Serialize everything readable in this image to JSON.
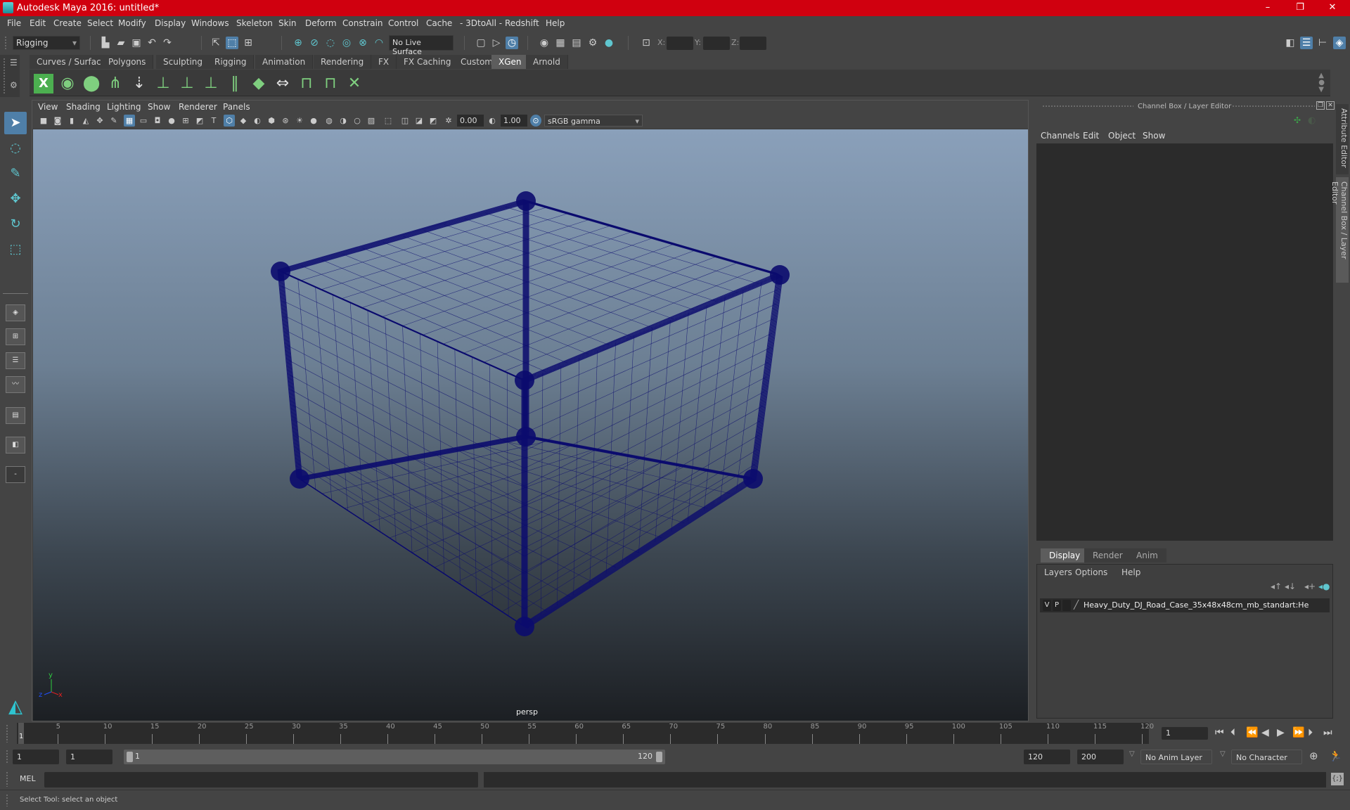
{
  "window": {
    "title": "Autodesk Maya 2016: untitled*",
    "controls": {
      "minimize": "–",
      "maximize": "❐",
      "close": "✕"
    }
  },
  "menubar": [
    "File",
    "Edit",
    "Create",
    "Select",
    "Modify",
    "Display",
    "Windows",
    "Skeleton",
    "Skin",
    "Deform",
    "Constrain",
    "Control",
    "Cache",
    "- 3DtoAll -",
    "Redshift",
    "Help"
  ],
  "statusline": {
    "mode": "Rigging",
    "live_surface": "No Live Surface",
    "coord_labels": {
      "x": "X:",
      "y": "Y:",
      "z": "Z:"
    },
    "coord_values": {
      "x": "",
      "y": "",
      "z": ""
    }
  },
  "shelf": {
    "tabs": [
      "Curves / Surfaces",
      "Polygons",
      "Sculpting",
      "Rigging",
      "Animation",
      "Rendering",
      "FX",
      "FX Caching",
      "Custom",
      "XGen",
      "Arnold"
    ],
    "active_tab": "XGen",
    "icons": [
      "xgen-editor-icon",
      "xgen-preview-icon",
      "xgen-clear-preview-icon",
      "xgen-interactive-groom-icon",
      "xgen-create-description-icon",
      "xgen-add-guide-icon",
      "xgen-sculpt-guide-icon",
      "xgen-lock-guide-icon",
      "xgen-split-guide-icon",
      "xgen-grid-icon",
      "xgen-bend-icon",
      "xgen-select-guide-icon",
      "xgen-guide-box-icon",
      "xgen-delete-guide-icon"
    ]
  },
  "viewport": {
    "menu": [
      "View",
      "Shading",
      "Lighting",
      "Show",
      "Renderer",
      "Panels"
    ],
    "exposure": "0.00",
    "gamma": "1.00",
    "color_space": "sRGB gamma",
    "camera_label": "persp",
    "axis": {
      "x": "x",
      "y": "y",
      "z": "z"
    },
    "wire_color": "#0b0b6e"
  },
  "channel_box": {
    "title": "Channel Box / Layer Editor",
    "menu": [
      "Channels",
      "Edit",
      "Object",
      "Show"
    ]
  },
  "layer_editor": {
    "tabs": [
      "Display",
      "Render",
      "Anim"
    ],
    "active_tab": "Display",
    "menu": [
      "Layers",
      "Options",
      "Help"
    ],
    "layers": [
      {
        "visible": "V",
        "playback": "P",
        "name": "Heavy_Duty_DJ_Road_Case_35x48x48cm_mb_standart:He"
      }
    ]
  },
  "side_tabs": [
    "Attribute Editor",
    "Channel Box / Layer Editor"
  ],
  "timeline": {
    "start": 1,
    "end": 120,
    "current_frame_label": "1",
    "tick_labels": [
      "5",
      "10",
      "15",
      "20",
      "25",
      "30",
      "35",
      "40",
      "45",
      "50",
      "55",
      "60",
      "65",
      "70",
      "75",
      "80",
      "85",
      "90",
      "95",
      "100",
      "105",
      "110",
      "115",
      "120"
    ],
    "current_frame_field": "1"
  },
  "range": {
    "start_field": "1",
    "playback_start": "1",
    "slider_start": "1",
    "slider_end": "120",
    "playback_end": "120",
    "end_field": "200",
    "anim_layer": "No Anim Layer",
    "character_set": "No Character Set"
  },
  "command_line": {
    "language": "MEL",
    "input": "",
    "output": ""
  },
  "help_line": "Select Tool: select an object"
}
